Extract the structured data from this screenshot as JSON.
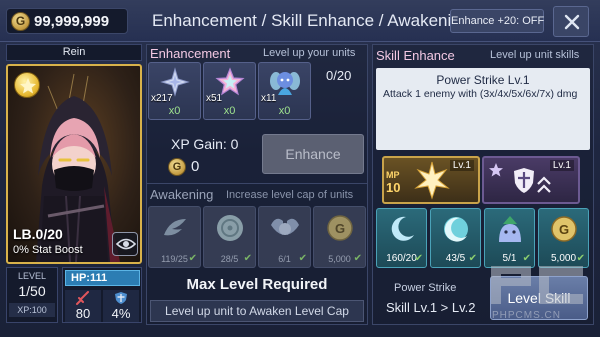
{
  "top_bar": {
    "gold_amount": "99,999,999",
    "gold_coin_letter": "G",
    "title": "Enhancement / Skill Enhance / Awakening",
    "enhance_toggle_label": "Enhance +20: OFF",
    "close_icon": "close-icon"
  },
  "unit": {
    "name": "Rein",
    "limit_break": "LB.0/20",
    "stat_boost": "0% Stat Boost",
    "level_label": "LEVEL",
    "level_value": "1/50",
    "xp": "XP:100",
    "hp": "HP:111",
    "atk": "80",
    "def": "4%",
    "frame_color": "#d8b24a"
  },
  "enhancement": {
    "heading": "Enhancement",
    "subheading": "Level up your units",
    "count": "0/20",
    "items": [
      {
        "icon": "silver-star-crystal-icon",
        "quantity": "x217",
        "selected": "x0"
      },
      {
        "icon": "rainbow-star-crystal-icon",
        "quantity": "x51",
        "selected": "x0"
      },
      {
        "icon": "fairy-slime-icon",
        "quantity": "x11",
        "selected": "x0"
      }
    ],
    "xp_gain": "XP Gain: 0",
    "gold_letter": "G",
    "gold_cost": "0",
    "enhance_button": "Enhance"
  },
  "awakening": {
    "heading": "Awakening",
    "subheading": "Increase level cap of units",
    "materials": [
      {
        "icon": "feather-icon",
        "count": "119/25"
      },
      {
        "icon": "disc-icon",
        "count": "28/5"
      },
      {
        "icon": "wing-emblem-icon",
        "count": "6/1"
      },
      {
        "icon": "gold-coin-icon",
        "count": "5,000"
      }
    ],
    "status": "Max Level Required",
    "awaken_button": "Level up unit to Awaken Level Cap"
  },
  "skill_enhance": {
    "heading": "Skill Enhance",
    "subheading": "Level up unit skills",
    "skill_name": "Power Strike Lv.1",
    "skill_description": "Attack 1 enemy with (3x/4x/5x/6x/7x) dmg",
    "skills": [
      {
        "icon": "power-strike-icon",
        "mp_label": "MP",
        "mp_value": "10",
        "level": "Lv.1"
      },
      {
        "icon": "guard-up-icon",
        "level": "Lv.1"
      }
    ],
    "books": [
      {
        "icon": "blue-moon-book-icon",
        "count": "160/20"
      },
      {
        "icon": "cyan-moon-book-icon",
        "count": "43/5"
      },
      {
        "icon": "slime-book-icon",
        "count": "5/1"
      },
      {
        "icon": "gold-coin-icon",
        "count": "5,000"
      }
    ],
    "info_label": "Power Strike",
    "info_value": "Skill Lv.1 > Lv.2",
    "level_skill_button": "Level Skill"
  },
  "watermark": {
    "text": "PHPCMS.CN"
  },
  "colors": {
    "accent_pink": "#f2c8e3",
    "gold": "#d8b24a",
    "hp_blue": "#2c7db3",
    "check_green": "#8ccf6f"
  }
}
